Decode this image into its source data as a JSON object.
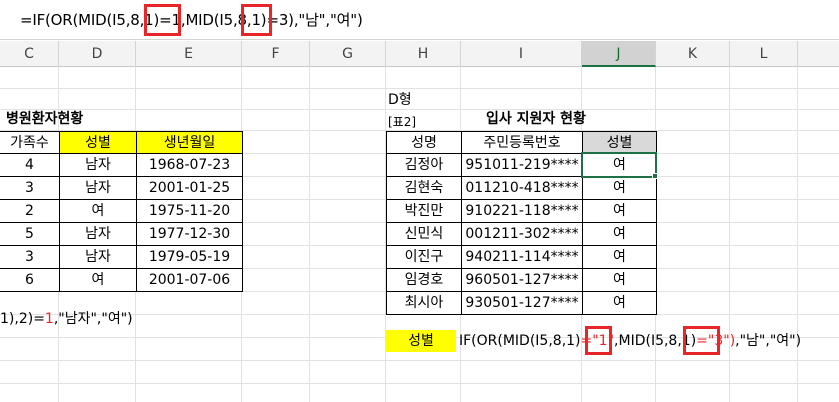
{
  "formula_bar": {
    "formula_text": "=IF(OR(MID(I5,8,1)=1,MID(I5,8,1)=3),\"남\",\"여\")"
  },
  "columns": [
    "C",
    "D",
    "E",
    "F",
    "G",
    "H",
    "I",
    "J",
    "K",
    "L"
  ],
  "selected_column": "J",
  "left_table": {
    "title": "병원환자현황",
    "headers": [
      "가족수",
      "성별",
      "생년월일"
    ],
    "rows": [
      [
        "4",
        "남자",
        "1968-07-23"
      ],
      [
        "3",
        "남자",
        "2001-01-25"
      ],
      [
        "2",
        "여",
        "1975-11-20"
      ],
      [
        "5",
        "남자",
        "1977-12-30"
      ],
      [
        "3",
        "남자",
        "1979-05-19"
      ],
      [
        "6",
        "여",
        "2001-07-06"
      ]
    ],
    "formula_fragment_a": "1),2)=",
    "formula_fragment_b": "1",
    "formula_fragment_c": ",\"남자\",\"여\")"
  },
  "right_table": {
    "label_type": "D형",
    "label_table": "[표2]",
    "title": "입사 지원자 현황",
    "headers": [
      "성명",
      "주민등록번호",
      "성별"
    ],
    "rows": [
      [
        "김정아",
        "951011-219****",
        "여"
      ],
      [
        "김현숙",
        "011210-418****",
        "여"
      ],
      [
        "박진만",
        "910221-118****",
        "여"
      ],
      [
        "신민식",
        "001211-302****",
        "여"
      ],
      [
        "이진구",
        "940211-114****",
        "여"
      ],
      [
        "임경호",
        "960501-127****",
        "여"
      ],
      [
        "최시아",
        "930501-127****",
        "여"
      ]
    ]
  },
  "answer": {
    "label": "성별",
    "part1": "IF(OR(MID(I5,8,1)",
    "part2": "=\"1\"",
    "part3": ",MID(I5,8,1)",
    "part4": "=\"3\")",
    "part5": ",\"남\",\"여\")"
  }
}
